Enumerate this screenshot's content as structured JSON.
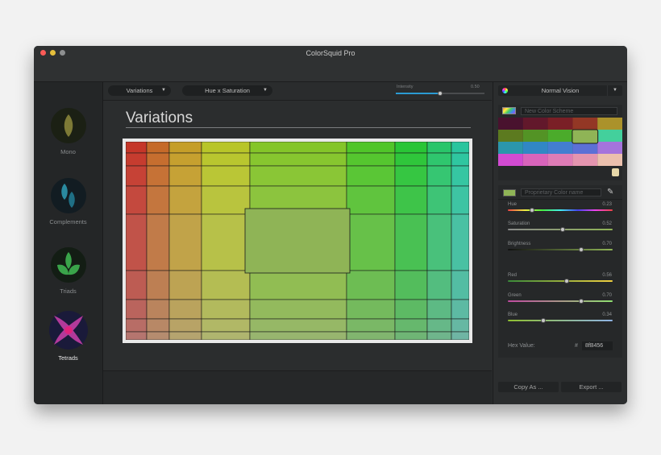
{
  "app": {
    "title": "ColorSquid Pro"
  },
  "window_controls": {
    "close": "close",
    "minimize": "minimize",
    "zoom": "zoom"
  },
  "sidebar": {
    "items": [
      {
        "label": "Mono",
        "icon": "leaf-icon",
        "active": false
      },
      {
        "label": "Complements",
        "icon": "complements-icon",
        "active": false
      },
      {
        "label": "Triads",
        "icon": "triads-icon",
        "active": false
      },
      {
        "label": "Tetrads",
        "icon": "tetrads-icon",
        "active": true
      }
    ]
  },
  "toolbar": {
    "variations_label": "Variations",
    "mode_label": "Hue x Saturation",
    "intensity_label": "Intensity",
    "intensity_value": "0.50",
    "intensity_level": 0.5
  },
  "main": {
    "heading": "Variations"
  },
  "right_panel": {
    "vision_label": "Normal Vision",
    "scheme_placeholder": "New Color Scheme",
    "color_name_placeholder": "Proprietary Color name",
    "sliders": [
      {
        "label": "Hue",
        "value": "0.23",
        "level": 0.23
      },
      {
        "label": "Saturation",
        "value": "0.52",
        "level": 0.52
      },
      {
        "label": "Brightness",
        "value": "0.70",
        "level": 0.7
      },
      {
        "label": "Red",
        "value": "0.56",
        "level": 0.56
      },
      {
        "label": "Green",
        "value": "0.70",
        "level": 0.7
      },
      {
        "label": "Blue",
        "value": "0.34",
        "level": 0.34
      }
    ],
    "hex_label": "Hex Value:",
    "hex_hash": "#",
    "hex_value": "8fB456",
    "copy_button": "Copy As ...",
    "export_button": "Export ..."
  },
  "colors": {
    "selected": "#8fB456"
  }
}
